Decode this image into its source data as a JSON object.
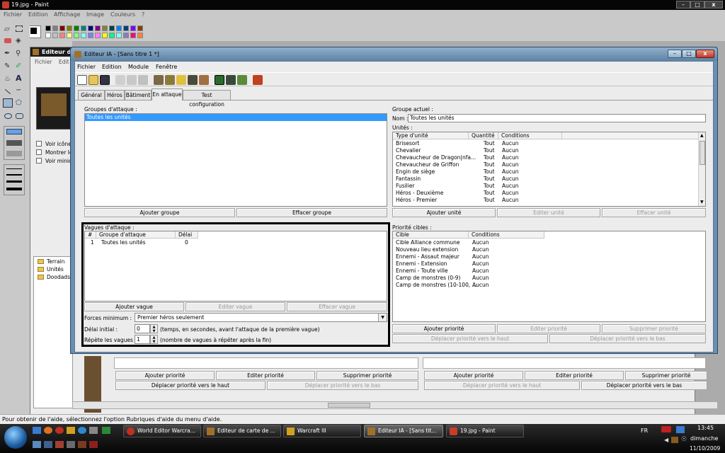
{
  "paint": {
    "title": "19.jpg - Paint",
    "menu": [
      "Fichier",
      "Edition",
      "Affichage",
      "Image",
      "Couleurs",
      "?"
    ],
    "palette_top": [
      "#000000",
      "#808080",
      "#800000",
      "#808000",
      "#008000",
      "#008080",
      "#000080",
      "#800080",
      "#808040",
      "#004040",
      "#0080ff",
      "#004080",
      "#8000ff",
      "#804000"
    ],
    "palette_bottom": [
      "#ffffff",
      "#c0c0c0",
      "#ff8080",
      "#ffff80",
      "#80ff80",
      "#80ffff",
      "#8080ff",
      "#ff80ff",
      "#ffff00",
      "#00ff80",
      "#80ffff",
      "#8080c0",
      "#ff0080",
      "#ff8040"
    ],
    "status": "Pour obtenir de l'aide, sélectionnez l'option Rubriques d'aide du menu d'aide."
  },
  "bg_editor": {
    "title": "Editeur de",
    "menu": [
      "Fichier",
      "Edit"
    ],
    "checkboxes": [
      "Voir icône",
      "Montrer le",
      "Voir minica"
    ],
    "tree": [
      "Terrain",
      "Unités",
      "Doodads"
    ],
    "buttons_row1": [
      "Ajouter priorité",
      "Editer priorité",
      "Supprimer priorité",
      "Ajouter priorité",
      "Editer priorité",
      "Supprimer priorité"
    ],
    "buttons_row2": [
      "Déplacer priorité vers le haut",
      "Déplacer priorité vers le bas",
      "Déplacer priorité vers le haut",
      "Déplacer priorité vers le bas"
    ]
  },
  "ai_editor": {
    "title": "Editeur IA - [Sans titre 1 *]",
    "menu": [
      "Fichier",
      "Edition",
      "Module",
      "Fenêtre"
    ],
    "tabs": [
      "Général",
      "Héros",
      "Bâtiment",
      "En attaque",
      "Test configuration"
    ],
    "active_tab": "En attaque",
    "attack_groups": {
      "label": "Groupes d'attaque :",
      "items": [
        "Toutes les unités"
      ],
      "add": "Ajouter groupe",
      "delete": "Effacer groupe"
    },
    "current_group": {
      "label": "Groupe actuel :",
      "name_label": "Nom :",
      "name_value": "Toutes les unités",
      "units_label": "Unités :",
      "columns": [
        "Type d'unité",
        "Quantité",
        "Conditions"
      ],
      "units": [
        [
          "Brisesort",
          "Tout",
          "Aucun"
        ],
        [
          "Chevalier",
          "Tout",
          "Aucun"
        ],
        [
          "Chevaucheur de Dragon|nfa...",
          "Tout",
          "Aucun"
        ],
        [
          "Chevaucheur de Griffon",
          "Tout",
          "Aucun"
        ],
        [
          "Engin de siège",
          "Tout",
          "Aucun"
        ],
        [
          "Fantassin",
          "Tout",
          "Aucun"
        ],
        [
          "Fusilier",
          "Tout",
          "Aucun"
        ],
        [
          "Héros - Deuxième",
          "Tout",
          "Aucun"
        ],
        [
          "Héros - Premier",
          "Tout",
          "Aucun"
        ]
      ],
      "add": "Ajouter unité",
      "edit": "Editer unité",
      "delete": "Effacer unité"
    },
    "waves": {
      "label": "Vagues d'attaque :",
      "columns": [
        "#",
        "Groupe d'attaque",
        "Délai"
      ],
      "rows": [
        [
          "1",
          "Toutes les unités",
          "0"
        ]
      ],
      "add": "Ajouter vague",
      "edit": "Editer vague",
      "delete": "Effacer vague",
      "forces_label": "Forces minimum :",
      "forces_value": "Premier héros seulement",
      "delay_label": "Délai initial :",
      "delay_value": "0",
      "delay_hint": "(temps, en secondes, avant l'attaque de la première vague)",
      "repeat_label": "Répète les vagues :",
      "repeat_value": "1",
      "repeat_hint": "(nombre de vagues à répéter après la fin)"
    },
    "targets": {
      "label": "Priorité cibles :",
      "columns": [
        "Cible",
        "Conditions"
      ],
      "rows": [
        [
          "Cible Alliance commune",
          "Aucun"
        ],
        [
          "Nouveau lieu extension",
          "Aucun"
        ],
        [
          "Ennemi - Assaut majeur",
          "Aucun"
        ],
        [
          "Ennemi - Extension",
          "Aucun"
        ],
        [
          "Ennemi - Toute ville",
          "Aucun"
        ],
        [
          "Camp de monstres (0-9)",
          "Aucun"
        ],
        [
          "Camp de monstres (10-100, ...",
          "Aucun"
        ]
      ],
      "add": "Ajouter priorité",
      "edit": "Editer priorité",
      "delete": "Supprimer priorité",
      "up": "Déplacer priorité vers le haut",
      "down": "Déplacer priorité vers le bas"
    }
  },
  "taskbar": {
    "tasks": [
      "World Editor Warcra...",
      "Editeur de carte de ...",
      "Warcraft III",
      "Editeur IA - [Sans tit...",
      "19.jpg - Paint"
    ],
    "lang": "FR",
    "time": "13:45",
    "day": "dimanche",
    "date": "11/10/2009"
  }
}
